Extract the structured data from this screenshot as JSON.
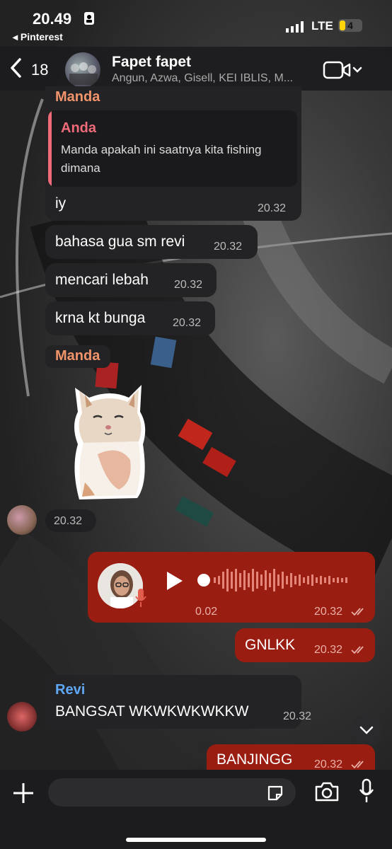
{
  "status_bar": {
    "time": "20.49",
    "back_app": "◂ Pinterest",
    "network": "LTE",
    "battery": "4"
  },
  "header": {
    "back_count": "18",
    "group_name": "Fapet fapet",
    "members": "Angun, Azwa, Gisell, KEI IBLIS, M..."
  },
  "messages": {
    "m1_sender": "Manda",
    "m1_quote_sender": "Anda",
    "m1_quote_line1": "Manda apakah ini saatnya kita fishing",
    "m1_quote_line2": "dimana",
    "m1_text": "iy",
    "m1_time": "20.32",
    "m2_text": "bahasa gua sm revi",
    "m2_time": "20.32",
    "m3_text": "mencari lebah",
    "m3_time": "20.32",
    "m4_text": "krna kt bunga",
    "m4_time": "20.32",
    "sticker_sender": "Manda",
    "sticker_time": "20.32",
    "voice_duration": "0.02",
    "voice_time": "20.32",
    "gnlkk_text": "GNLKK",
    "gnlkk_time": "20.32",
    "revi_sender": "Revi",
    "revi_text": "BANGSAT WKWKWKWKKW",
    "revi_time": "20.32",
    "banjingg_text": "BANJINGG",
    "banjingg_time": "20.32"
  },
  "colors": {
    "outgoing": "#9a1d12",
    "incoming": "#232325",
    "manda": "#f2946b",
    "anda": "#f06b7a",
    "revi": "#5fa8f5"
  }
}
